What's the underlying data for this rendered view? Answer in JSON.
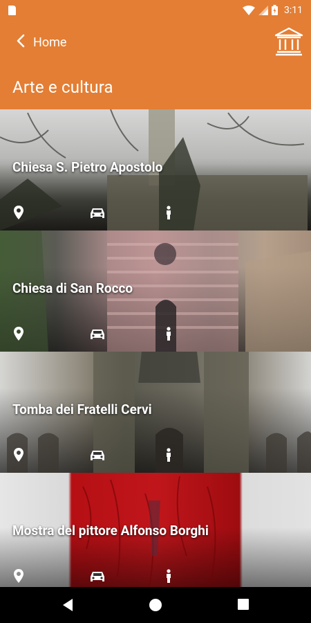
{
  "statusbar": {
    "time": "3:11",
    "icons": [
      "sd-card-icon",
      "wifi-icon",
      "signal-icon",
      "battery-icon"
    ]
  },
  "appbar": {
    "back_label": "Home",
    "title": "Arte e cultura",
    "right_icon": "museum-icon",
    "color": "#e37e34"
  },
  "items": [
    {
      "title": "Chiesa S. Pietro Apostolo",
      "icons": [
        "location-pin-icon",
        "car-icon",
        "walking-icon"
      ]
    },
    {
      "title": "Chiesa di San Rocco",
      "icons": [
        "location-pin-icon",
        "car-icon",
        "walking-icon"
      ]
    },
    {
      "title": "Tomba dei Fratelli Cervi",
      "icons": [
        "location-pin-icon",
        "car-icon",
        "walking-icon"
      ]
    },
    {
      "title": "Mostra del pittore Alfonso Borghi",
      "icons": [
        "location-pin-icon",
        "car-icon",
        "walking-icon"
      ]
    }
  ],
  "navbar": {
    "icons": [
      "nav-back-icon",
      "nav-home-icon",
      "nav-recents-icon"
    ]
  }
}
